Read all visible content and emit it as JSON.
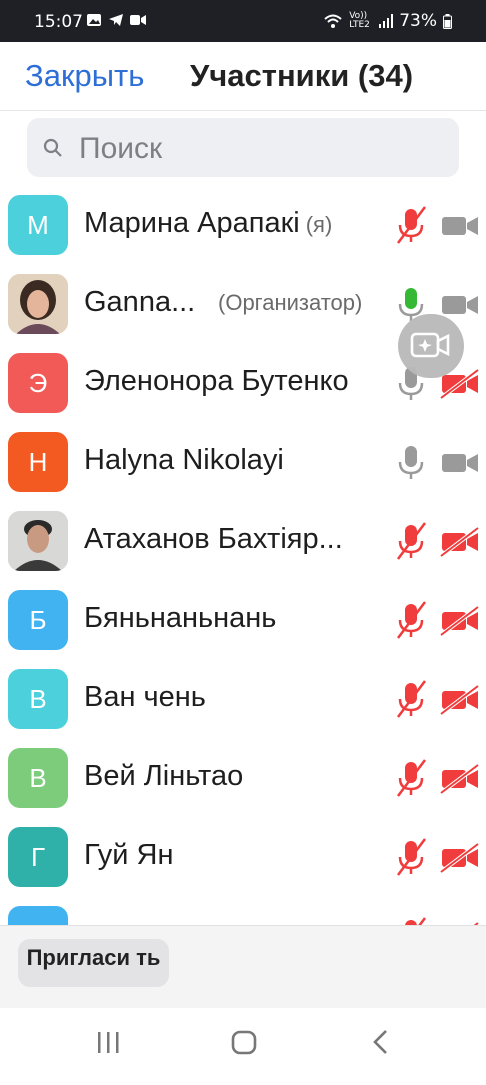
{
  "status_bar": {
    "time": "15:07",
    "network": "Vo)) LTE2",
    "battery": "73%"
  },
  "header": {
    "close_label": "Закрыть",
    "title": "Участники (34)"
  },
  "search": {
    "placeholder": "Поиск"
  },
  "participants": [
    {
      "initial": "М",
      "name": "Марина Арапакі",
      "tag": "(я)",
      "avatar_color": "#4cd0dc",
      "mic": "muted",
      "cam": "off-gray"
    },
    {
      "initial": "",
      "name": "Ganna...",
      "role": "(Организатор)",
      "avatar_type": "photo",
      "mic": "active",
      "cam": "off-gray"
    },
    {
      "initial": "Э",
      "name": "Эленонора Бутенко",
      "avatar_color": "#f25a58",
      "mic": "gray",
      "cam": "muted"
    },
    {
      "initial": "H",
      "name": "Halyna Nikolayi",
      "avatar_color": "#f25a22",
      "mic": "gray",
      "cam": "off-gray"
    },
    {
      "initial": "",
      "name": "Атаханов Бахтіяр...",
      "avatar_type": "photo",
      "mic": "muted",
      "cam": "muted"
    },
    {
      "initial": "Б",
      "name": "Бяньнаньнань",
      "avatar_color": "#41b3f0",
      "mic": "muted",
      "cam": "muted"
    },
    {
      "initial": "В",
      "name": "Ван чень",
      "avatar_color": "#4cd0dc",
      "mic": "muted",
      "cam": "muted"
    },
    {
      "initial": "В",
      "name": "Вей Ліньтао",
      "avatar_color": "#7dcc7b",
      "mic": "muted",
      "cam": "muted"
    },
    {
      "initial": "Г",
      "name": "Гуй Ян",
      "avatar_color": "#2fb0a8",
      "mic": "muted",
      "cam": "muted"
    },
    {
      "initial": "",
      "name": "",
      "avatar_color": "#41b3f0",
      "mic": "muted",
      "cam": "muted"
    }
  ],
  "bottom": {
    "invite_label": "Пригласи ть"
  },
  "colors": {
    "accent": "#2d6fd6",
    "muted_red": "#f03c3c",
    "active_green": "#35b935",
    "icon_gray": "#9a9a9a"
  }
}
